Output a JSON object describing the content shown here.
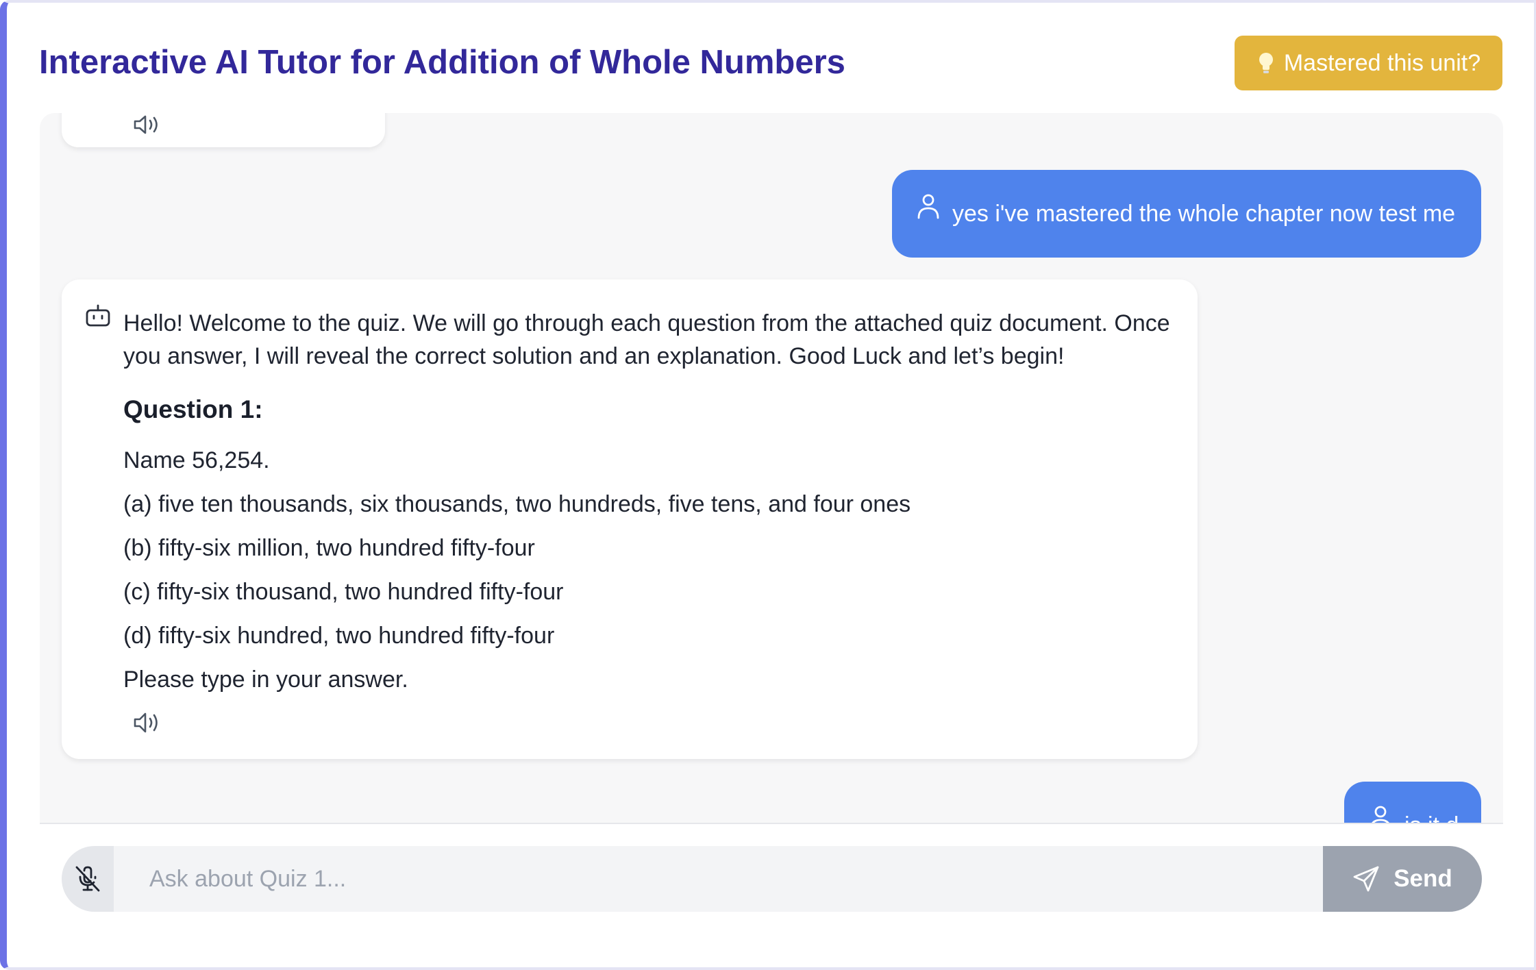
{
  "header": {
    "title": "Interactive AI Tutor for Addition of Whole Numbers",
    "mastered_button": "Mastered this unit?",
    "mastered_icon": "lightbulb-icon"
  },
  "chat": {
    "messages": [
      {
        "role": "user",
        "text": "yes i've mastered the whole chapter now test me",
        "icon": "user-icon"
      },
      {
        "role": "assistant",
        "icon": "bot-icon",
        "intro": "Hello! Welcome to the quiz. We will go through each question from the attached quiz document. Once you answer, I will reveal the correct solution and an explanation. Good Luck and let’s begin!",
        "question_heading": "Question 1:",
        "question_text": "Name 56,254.",
        "options": [
          "(a) five ten thousands, six thousands, two hundreds, five tens, and four ones",
          "(b) fifty-six million, two hundred fifty-four",
          "(c) fifty-six thousand, two hundred fifty-four",
          "(d) fifty-six hundred, two hundred fifty-four"
        ],
        "prompt": "Please type in your answer.",
        "audio_icon": "speaker-icon"
      },
      {
        "role": "user",
        "text": "is it d",
        "icon": "user-icon"
      }
    ]
  },
  "composer": {
    "placeholder": "Ask about Quiz 1...",
    "value": "",
    "mic_icon": "mic-off-icon",
    "send_label": "Send",
    "send_icon": "send-icon"
  },
  "colors": {
    "accent_border": "#6c72e6",
    "title": "#32289a",
    "mastered_button": "#e3b53d",
    "user_bubble": "#4f83ec",
    "send_button_disabled": "#9ca3af"
  }
}
